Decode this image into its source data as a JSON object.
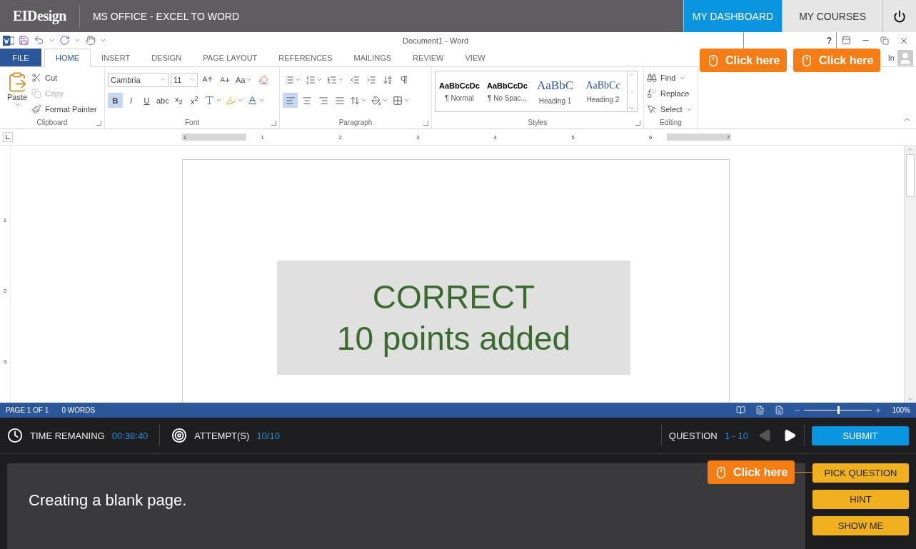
{
  "app_bar": {
    "logo": "EIDesign",
    "course_title": "MS OFFICE - EXCEL TO WORD",
    "nav": [
      {
        "label": "MY DASHBOARD",
        "selected": true
      },
      {
        "label": "MY COURSES",
        "selected": false
      }
    ]
  },
  "word": {
    "title": "Document1 - Word",
    "help": "?",
    "account": "In",
    "tabs": [
      {
        "label": "FILE",
        "kind": "file",
        "selected": false
      },
      {
        "label": "HOME",
        "kind": "tab",
        "selected": true
      },
      {
        "label": "INSERT",
        "kind": "tab",
        "selected": false
      },
      {
        "label": "DESIGN",
        "kind": "tab",
        "selected": false
      },
      {
        "label": "PAGE LAYOUT",
        "kind": "tab",
        "selected": false
      },
      {
        "label": "REFERENCES",
        "kind": "tab",
        "selected": false
      },
      {
        "label": "MAILINGS",
        "kind": "tab",
        "selected": false
      },
      {
        "label": "REVIEW",
        "kind": "tab",
        "selected": false
      },
      {
        "label": "VIEW",
        "kind": "tab",
        "selected": false
      }
    ],
    "clipboard": {
      "label": "Clipboard",
      "paste": "Paste",
      "items": [
        {
          "kind": "cut",
          "label": "Cut",
          "disabled": false
        },
        {
          "kind": "copy",
          "label": "Copy",
          "disabled": true
        },
        {
          "kind": "painter",
          "label": "Format Painter",
          "disabled": false
        }
      ]
    },
    "font": {
      "label": "Font",
      "name": "Cambria",
      "size": "11",
      "change_case": "Aa",
      "format": [
        {
          "kind": "text",
          "label": "B",
          "selected": true
        },
        {
          "kind": "text",
          "label": "I",
          "selected": false
        },
        {
          "kind": "text",
          "label": "U",
          "selected": false
        },
        {
          "kind": "text",
          "label": "abc",
          "selected": false
        },
        {
          "kind": "text",
          "label": "x$_{2}$",
          "selected": false
        },
        {
          "kind": "text",
          "label": "x$^{2}$",
          "selected": false
        },
        {
          "kind": "effects",
          "selected": false
        },
        {
          "kind": "highlight",
          "selected": false
        },
        {
          "kind": "color",
          "selected": false
        }
      ]
    },
    "paragraph": {
      "label": "Paragraph",
      "row1": [
        {
          "kind": "bullets",
          "selected": false
        },
        {
          "kind": "numbering",
          "selected": false
        },
        {
          "kind": "multilevel",
          "selected": false
        },
        {
          "kind": "outdent",
          "selected": false
        },
        {
          "kind": "indent",
          "selected": false
        },
        {
          "kind": "sort",
          "selected": false
        },
        {
          "kind": "marks",
          "selected": false
        }
      ],
      "row2": [
        {
          "kind": "left",
          "selected": true
        },
        {
          "kind": "center",
          "selected": false
        },
        {
          "kind": "right",
          "selected": false
        },
        {
          "kind": "justify",
          "selected": false
        },
        {
          "kind": "spacing",
          "selected": false
        },
        {
          "kind": "shading",
          "selected": false
        },
        {
          "kind": "borders",
          "selected": false
        }
      ]
    },
    "styles": {
      "label": "Styles",
      "items": [
        {
          "sample": "AaBbCcDc",
          "name": "¶ Normal",
          "kind": "body"
        },
        {
          "sample": "AaBbCcDc",
          "name": "¶ No Spac...",
          "kind": "body"
        },
        {
          "sample": "AaBbC",
          "name": "Heading 1",
          "kind": "heading1"
        },
        {
          "sample": "AaBbCc",
          "name": "Heading 2",
          "kind": "heading2"
        }
      ]
    },
    "editing": {
      "label": "Editing",
      "items": [
        {
          "kind": "find",
          "label": "Find"
        },
        {
          "kind": "replace",
          "label": "Replace"
        },
        {
          "kind": "select",
          "label": "Select"
        }
      ]
    },
    "ruler": [
      "1",
      "1",
      "2",
      "3",
      "4",
      "5",
      "6",
      "7"
    ],
    "vertical_ruler": [
      "1",
      "2",
      "3"
    ],
    "feedback": {
      "title": "CORRECT",
      "detail": "10 points added"
    },
    "status_bar": {
      "page": "PAGE 1 OF 1",
      "words": "0 WORDS",
      "zoom": {
        "level": 0.5
      },
      "zoom_reading": "100%"
    }
  },
  "quiz_bar": {
    "time_label": "TIME REMANING",
    "time": "00:38:40",
    "attempts_label": "ATTEMPT(S)",
    "attempts": "10/10",
    "question_label": "QUESTION",
    "question": "1 - 10",
    "prev": {
      "disabled": true
    },
    "next": {
      "disabled": false
    },
    "submit": "SUBMIT"
  },
  "task": {
    "text": "Creating a blank page.",
    "buttons": [
      "PICK QUESTION",
      "HINT",
      "SHOW ME"
    ]
  },
  "callouts": [
    {
      "text": "Click here"
    },
    {
      "text": "Click here"
    },
    {
      "text": "Click here"
    }
  ]
}
